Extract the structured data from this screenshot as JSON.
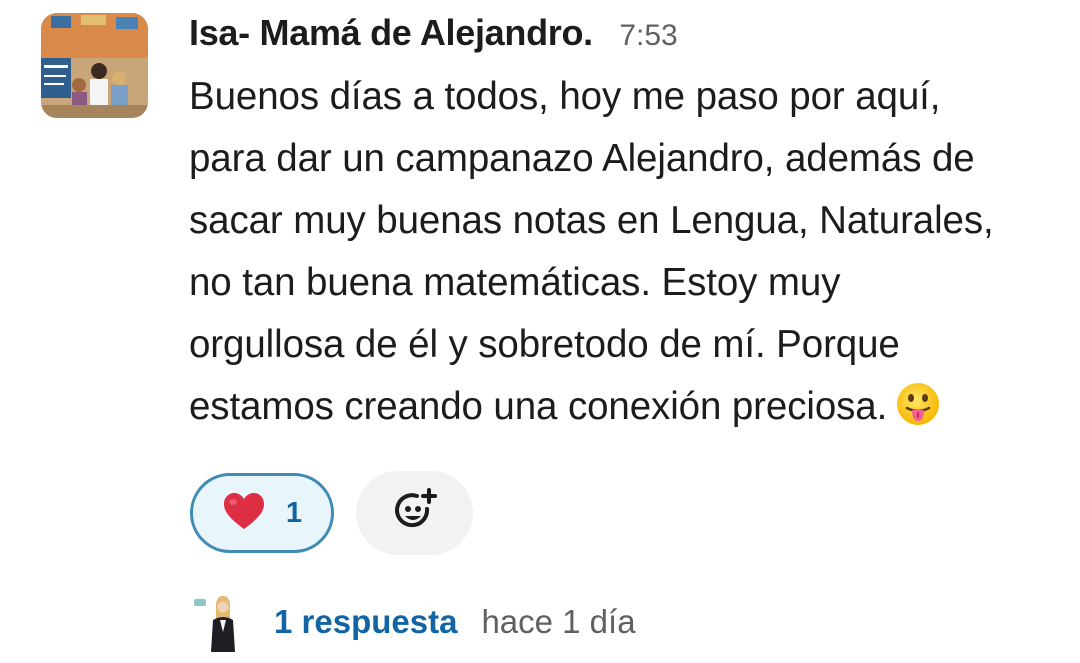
{
  "message": {
    "author": "Isa- Mamá de Alejandro.",
    "time": "7:53",
    "lines": [
      "Buenos días a todos, hoy me paso por aquí,",
      "para dar un campanazo Alejandro, además de",
      "sacar muy buenas notas en Lengua, Naturales,",
      "no tan buena matemáticas. Estoy muy",
      "orgullosa de él y sobretodo de mí. Porque",
      "estamos creando una conexión preciosa."
    ],
    "trailing_emoji": "face-with-tongue-emoji"
  },
  "reactions": [
    {
      "emoji": "red-heart-emoji",
      "count": "1",
      "active": true
    }
  ],
  "add_reaction_icon": "add-reaction-icon",
  "thread": {
    "replies_label": "1 respuesta",
    "last_reply": "hace 1 día"
  },
  "colors": {
    "link": "#1264a3",
    "reaction_border": "#3e8bb5",
    "reaction_bg": "#e8f5fa",
    "text": "#1d1c1d",
    "muted": "#616061"
  }
}
